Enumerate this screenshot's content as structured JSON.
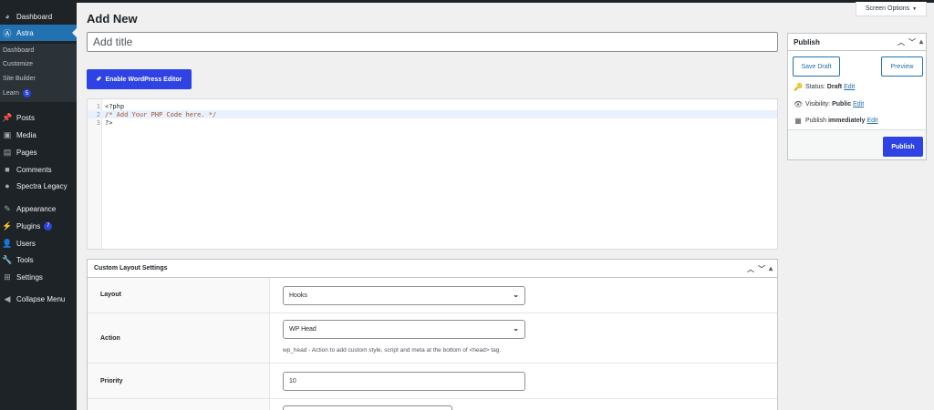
{
  "header": {
    "title": "Add New",
    "screen_options": "Screen Options"
  },
  "title_field": {
    "placeholder": "Add title",
    "value": ""
  },
  "editor_toggle": {
    "label": "Enable WordPress Editor"
  },
  "code": {
    "lines": [
      {
        "num": "1",
        "text": "<?php"
      },
      {
        "num": "2",
        "text": "/* Add Your PHP Code here. */"
      },
      {
        "num": "3",
        "text": "?>"
      }
    ]
  },
  "sidebar": {
    "items": [
      {
        "label": "Dashboard",
        "icon": "dashboard-icon"
      },
      {
        "label": "Astra",
        "icon": "astra-icon"
      },
      {
        "label": "Posts",
        "icon": "pin-icon"
      },
      {
        "label": "Media",
        "icon": "media-icon"
      },
      {
        "label": "Pages",
        "icon": "pages-icon"
      },
      {
        "label": "Comments",
        "icon": "comment-icon"
      },
      {
        "label": "Spectra Legacy",
        "icon": "spectra-icon"
      },
      {
        "label": "Appearance",
        "icon": "brush-icon"
      },
      {
        "label": "Plugins",
        "icon": "plug-icon",
        "badge": "7"
      },
      {
        "label": "Users",
        "icon": "user-icon"
      },
      {
        "label": "Tools",
        "icon": "wrench-icon"
      },
      {
        "label": "Settings",
        "icon": "settings-icon"
      },
      {
        "label": "Collapse Menu",
        "icon": "collapse-icon"
      }
    ],
    "submenu": [
      {
        "label": "Dashboard"
      },
      {
        "label": "Customize"
      },
      {
        "label": "Site Builder"
      },
      {
        "label": "Learn",
        "badge": "5"
      }
    ]
  },
  "publish": {
    "title": "Publish",
    "save_draft": "Save Draft",
    "preview": "Preview",
    "status_label": "Status:",
    "status_value": "Draft",
    "visibility_label": "Visibility:",
    "visibility_value": "Public",
    "schedule_label": "Publish",
    "schedule_value": "immediately",
    "edit": "Edit",
    "publish_button": "Publish"
  },
  "custom_layout": {
    "title": "Custom Layout Settings",
    "layout_label": "Layout",
    "layout_value": "Hooks",
    "action_label": "Action",
    "action_value": "WP Head",
    "action_desc": "wp_head - Action to add custom style, script and meta at the bottom of <head> tag.",
    "priority_label": "Priority",
    "priority_value": "10"
  },
  "colors": {
    "accent": "#2f43e4",
    "sidebar": "#1d2327",
    "active": "#2271b1"
  }
}
